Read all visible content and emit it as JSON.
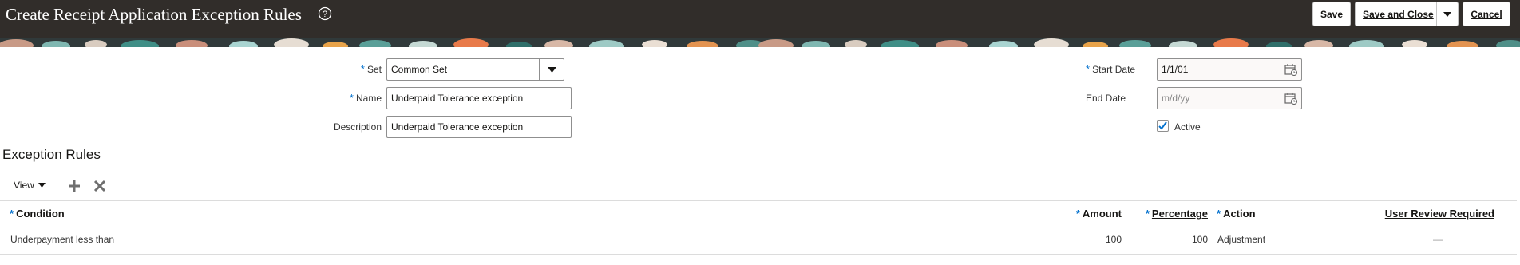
{
  "header": {
    "title": "Create Receipt Application Exception Rules",
    "save_label": "Save",
    "save_and_close_label": "Save and Close",
    "cancel_label": "Cancel"
  },
  "form": {
    "set": {
      "label": "Set",
      "value": "Common Set"
    },
    "name": {
      "label": "Name",
      "value": "Underpaid Tolerance exception"
    },
    "description": {
      "label": "Description",
      "value": "Underpaid Tolerance exception"
    },
    "start_date": {
      "label": "Start Date",
      "value": "1/1/01"
    },
    "end_date": {
      "label": "End Date",
      "placeholder": "m/d/yy"
    },
    "active": {
      "label": "Active",
      "checked": true
    }
  },
  "section": {
    "title": "Exception Rules"
  },
  "toolbar": {
    "view_label": "View"
  },
  "table": {
    "headers": {
      "condition": "Condition",
      "amount": "Amount",
      "percentage": "Percentage",
      "action": "Action",
      "user_review": "User Review Required"
    },
    "rows": [
      {
        "condition": "Underpayment less than",
        "amount": "100",
        "percentage": "100",
        "action": "Adjustment",
        "user_review": "—"
      }
    ]
  },
  "colors": {
    "header_bg": "#312d2a",
    "required": "#0572ce",
    "checkbox": "#0572ce"
  },
  "icons": [
    "help-icon",
    "chevron-down-icon",
    "calendar-icon",
    "checkmark-icon",
    "add-icon",
    "delete-icon"
  ]
}
